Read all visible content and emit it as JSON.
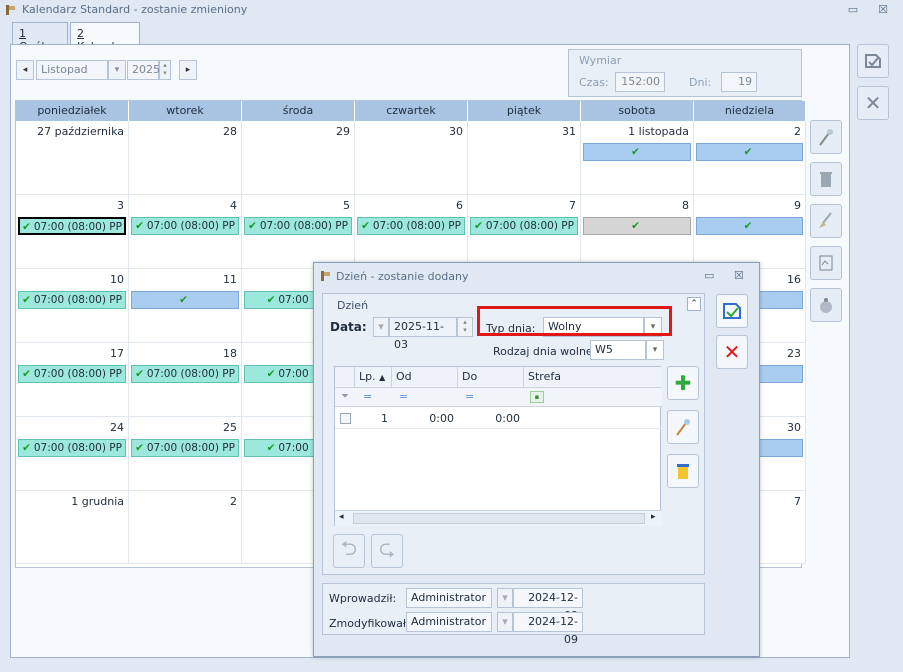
{
  "window": {
    "title": "Kalendarz Standard - zostanie zmieniony",
    "minimize_label": "▭",
    "close_label": "☒"
  },
  "tabs": [
    {
      "num": "1",
      "label": " Ogólne"
    },
    {
      "num": "2",
      "label": " Kalendarz"
    }
  ],
  "nav": {
    "prev": "◂",
    "next": "▸",
    "month": "Listopad",
    "year": "2025"
  },
  "wymiar": {
    "title": "Wymiar",
    "czas_label": "Czas:",
    "czas_value": "152:00",
    "dni_label": "Dni:",
    "dni_value": "19"
  },
  "weekdays": [
    "poniedziałek",
    "wtorek",
    "środa",
    "czwartek",
    "piątek",
    "sobota",
    "niedziela"
  ],
  "weeks": [
    {
      "days": [
        {
          "num": "27 października",
          "ev": ""
        },
        {
          "num": "28",
          "ev": ""
        },
        {
          "num": "29",
          "ev": ""
        },
        {
          "num": "30",
          "ev": ""
        },
        {
          "num": "31",
          "ev": ""
        },
        {
          "num": "1 listopada",
          "ev": "free",
          "text": ""
        },
        {
          "num": "2",
          "ev": "free",
          "text": ""
        }
      ]
    },
    {
      "days": [
        {
          "num": "3",
          "ev": "work sel",
          "text": "07:00 (08:00) PP"
        },
        {
          "num": "4",
          "ev": "work",
          "text": "07:00 (08:00) PP"
        },
        {
          "num": "5",
          "ev": "work",
          "text": "07:00 (08:00) PP"
        },
        {
          "num": "6",
          "ev": "work",
          "text": "07:00 (08:00) PP"
        },
        {
          "num": "7",
          "ev": "work",
          "text": "07:00 (08:00) PP"
        },
        {
          "num": "8",
          "ev": "gray",
          "text": ""
        },
        {
          "num": "9",
          "ev": "free",
          "text": ""
        }
      ]
    },
    {
      "days": [
        {
          "num": "10",
          "ev": "work",
          "text": "07:00 (08:00) PP"
        },
        {
          "num": "11",
          "ev": "free",
          "text": ""
        },
        {
          "num": "",
          "ev": "work",
          "text": "07:00 (08"
        },
        {
          "num": "",
          "ev": ""
        },
        {
          "num": "",
          "ev": ""
        },
        {
          "num": "",
          "ev": ""
        },
        {
          "num": "16",
          "ev": "free",
          "text": ""
        }
      ]
    },
    {
      "days": [
        {
          "num": "17",
          "ev": "work",
          "text": "07:00 (08:00) PP"
        },
        {
          "num": "18",
          "ev": "work",
          "text": "07:00 (08:00) PP"
        },
        {
          "num": "",
          "ev": "work",
          "text": "07:00 (08"
        },
        {
          "num": "",
          "ev": ""
        },
        {
          "num": "",
          "ev": ""
        },
        {
          "num": "",
          "ev": ""
        },
        {
          "num": "23",
          "ev": "free",
          "text": ""
        }
      ]
    },
    {
      "days": [
        {
          "num": "24",
          "ev": "work",
          "text": "07:00 (08:00) PP"
        },
        {
          "num": "25",
          "ev": "work",
          "text": "07:00 (08:00) PP"
        },
        {
          "num": "",
          "ev": "work",
          "text": "07:00 (08"
        },
        {
          "num": "",
          "ev": ""
        },
        {
          "num": "",
          "ev": ""
        },
        {
          "num": "",
          "ev": ""
        },
        {
          "num": "30",
          "ev": "free",
          "text": ""
        }
      ]
    },
    {
      "days": [
        {
          "num": "1 grudnia",
          "ev": ""
        },
        {
          "num": "2",
          "ev": ""
        },
        {
          "num": "",
          "ev": ""
        },
        {
          "num": "",
          "ev": ""
        },
        {
          "num": "",
          "ev": ""
        },
        {
          "num": "",
          "ev": ""
        },
        {
          "num": "7",
          "ev": ""
        }
      ]
    }
  ],
  "dialog": {
    "title": "Dzień - zostanie dodany",
    "group_label": "Dzień",
    "data_label": "Data:",
    "data_value": "2025-11-03",
    "typ_label": "Typ dnia:",
    "typ_value": "Wolny",
    "rodzaj_label": "Rodzaj dnia wolnego:",
    "rodzaj_value": "W5",
    "grid_headers": [
      "Lp.",
      "Od godziny",
      "Do godziny",
      "Strefa"
    ],
    "filter_symbol": "=",
    "row": {
      "lp": "1",
      "od": "0:00",
      "do": "0:00",
      "strefa": ""
    },
    "wprowadzil_label": "Wprowadził:",
    "wprowadzil_user": "Administrator",
    "wprowadzil_date": "2024-12-09",
    "zmodyfikowal_label": "Zmodyfikował:",
    "zmodyfikowal_user": "Administrator",
    "zmodyfikowal_date": "2024-12-09"
  },
  "colors": {
    "accent": "#a9c4e3",
    "work": "#9de8dc",
    "free": "#a9cdf0",
    "highlight": "#e01818"
  }
}
